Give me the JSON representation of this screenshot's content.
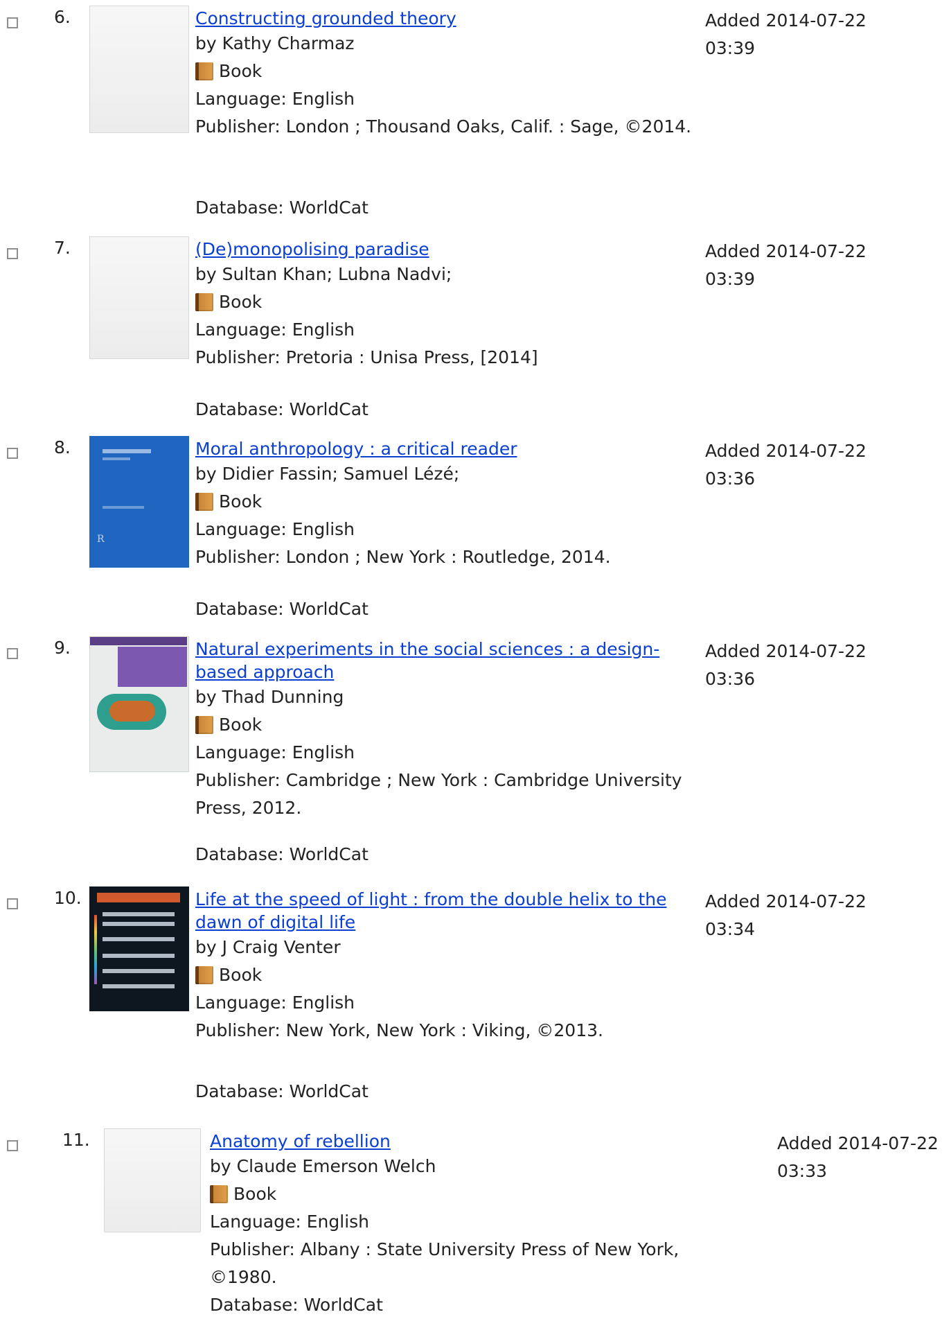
{
  "records": [
    {
      "number": "6.",
      "title": "Constructing grounded theory",
      "author": "by Kathy Charmaz",
      "type": "Book",
      "language": "Language: English",
      "publisher": "Publisher: London ; Thousand Oaks, Calif. : Sage, ©2014.",
      "database": "Database: WorldCat",
      "added_date": "Added 2014-07-22",
      "added_time": "03:39",
      "cover": "blank"
    },
    {
      "number": "7.",
      "title": "(De)monopolising paradise",
      "author": "by Sultan Khan; Lubna Nadvi;",
      "type": "Book",
      "language": "Language: English",
      "publisher": "Publisher: Pretoria : Unisa Press, [2014]",
      "database": "Database: WorldCat",
      "added_date": "Added 2014-07-22",
      "added_time": "03:39",
      "cover": "blank"
    },
    {
      "number": "8.",
      "title": "Moral anthropology : a critical reader",
      "author": "by Didier Fassin; Samuel Lézé;",
      "type": "Book",
      "language": "Language: English",
      "publisher": "Publisher: London ; New York : Routledge, 2014.",
      "database": "Database: WorldCat",
      "added_date": "Added 2014-07-22",
      "added_time": "03:36",
      "cover": "blue"
    },
    {
      "number": "9.",
      "title": "Natural experiments in the social sciences : a design-based approach",
      "author": "by Thad Dunning",
      "type": "Book",
      "language": "Language: English",
      "publisher": "Publisher: Cambridge ; New York : Cambridge University Press, 2012.",
      "database": "Database: WorldCat",
      "added_date": "Added 2014-07-22",
      "added_time": "03:36",
      "cover": "map"
    },
    {
      "number": "10.",
      "title": "Life at the speed of light : from the double helix to the dawn of digital life",
      "author": "by J Craig Venter",
      "type": "Book",
      "language": "Language: English",
      "publisher": "Publisher: New York, New York : Viking, ©2013.",
      "database": "Database: WorldCat",
      "added_date": "Added 2014-07-22",
      "added_time": "03:34",
      "cover": "dark"
    },
    {
      "number": "11.",
      "title": "Anatomy of rebellion",
      "author": "by Claude Emerson Welch",
      "type": "Book",
      "language": "Language: English",
      "publisher": "Publisher: Albany : State University Press of New York, ©1980.",
      "database": "Database: WorldCat",
      "added_date": "Added 2014-07-22",
      "added_time": "03:33",
      "cover": "blank"
    }
  ],
  "icons": {
    "checkbox": "checkbox-icon",
    "book": "book-icon"
  },
  "colors": {
    "link": "#0b3fd1",
    "text": "#222222",
    "checkbox_border": "#8e8e8e"
  }
}
